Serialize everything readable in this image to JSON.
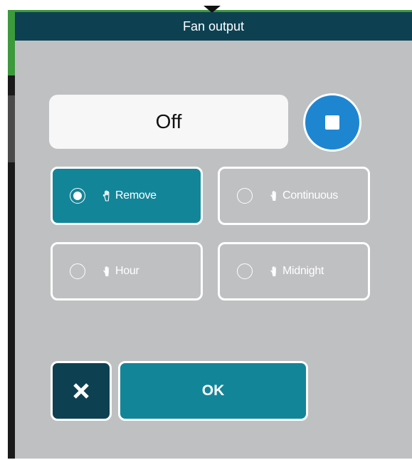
{
  "dialog": {
    "title": "Fan output",
    "current_value": "Off",
    "stop_button_icon": "stop-icon"
  },
  "options": [
    {
      "label": "Remove",
      "selected": true,
      "icon": "hand-icon"
    },
    {
      "label": "Continuous",
      "selected": false,
      "icon": "hand-icon"
    },
    {
      "label": "Hour",
      "selected": false,
      "icon": "hand-icon"
    },
    {
      "label": "Midnight",
      "selected": false,
      "icon": "hand-icon"
    }
  ],
  "buttons": {
    "cancel_icon": "close-icon",
    "ok_label": "OK"
  },
  "colors": {
    "title_bar": "#0d4152",
    "dialog_background": "#bfc0c2",
    "accent": "#138599",
    "stop_button": "#1e86d1"
  }
}
